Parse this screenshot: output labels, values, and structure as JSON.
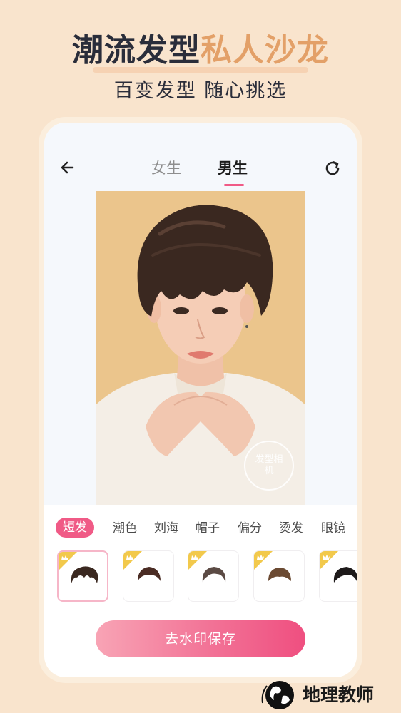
{
  "promo": {
    "headline_part1": "潮流发型",
    "headline_part2": "私人沙龙",
    "subheadline": "百变发型 随心挑选"
  },
  "topbar": {
    "back_icon": "arrow-left-icon",
    "refresh_icon": "refresh-icon",
    "tabs": [
      {
        "label": "女生",
        "active": false
      },
      {
        "label": "男生",
        "active": true
      }
    ]
  },
  "photo": {
    "watermark_text": "发型相机"
  },
  "categories": [
    {
      "label": "短发",
      "active": true
    },
    {
      "label": "潮色",
      "active": false
    },
    {
      "label": "刘海",
      "active": false
    },
    {
      "label": "帽子",
      "active": false
    },
    {
      "label": "偏分",
      "active": false
    },
    {
      "label": "烫发",
      "active": false
    },
    {
      "label": "眼镜",
      "active": false
    }
  ],
  "hairstyles": [
    {
      "icon": "short-hair-1-icon",
      "vip": true,
      "selected": true
    },
    {
      "icon": "short-hair-2-icon",
      "vip": true,
      "selected": false
    },
    {
      "icon": "short-hair-3-icon",
      "vip": true,
      "selected": false
    },
    {
      "icon": "short-hair-4-icon",
      "vip": true,
      "selected": false
    },
    {
      "icon": "short-hair-5-icon",
      "vip": true,
      "selected": false
    }
  ],
  "actions": {
    "save_label": "去水印保存"
  },
  "brand": {
    "name": "地理教师",
    "globe_icon": "globe-icon"
  },
  "colors": {
    "background": "#f9e4cd",
    "accent": "#f05a86",
    "headline_dark": "#2a2d3a",
    "headline_gold": "#e3a068",
    "photo_bg": "#ebc58c",
    "vip_badge": "#f2c94c"
  }
}
